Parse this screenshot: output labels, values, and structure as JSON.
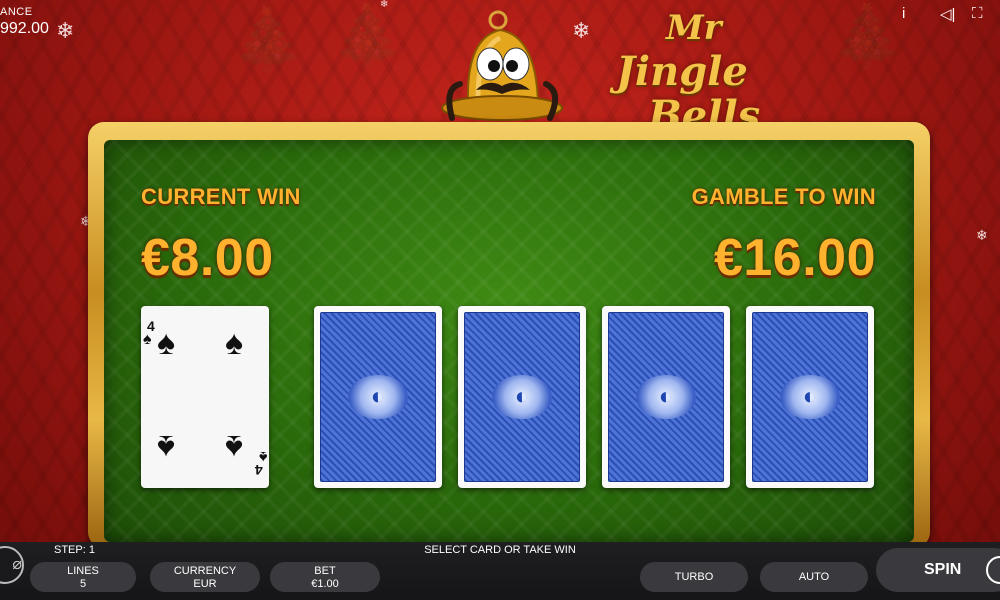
{
  "balance": {
    "label": "ANCE",
    "value": "992.00"
  },
  "topbar": {
    "info_icon": "i",
    "sound_icon": "◁|",
    "fullscreen_icon": "⛶"
  },
  "logo": {
    "mr": "Mr",
    "jingle": "Jingle",
    "bells": "Bells"
  },
  "gamble": {
    "current_win_label": "CURRENT WIN",
    "current_win_value": "€8.00",
    "gamble_to_win_label": "GAMBLE TO WIN",
    "gamble_to_win_value": "€16.00"
  },
  "cards": {
    "revealed": {
      "rank": "4",
      "suit": "♠"
    },
    "face_down_count_label": ""
  },
  "bottom": {
    "step_label": "STEP: 1",
    "instruction": "SELECT CARD OR TAKE WIN",
    "lines_label": "LINES",
    "lines_value": "5",
    "currency_label": "CURRENCY",
    "currency_value": "EUR",
    "bet_label": "BET",
    "bet_value": "€1.00",
    "turbo_label": "TURBO",
    "auto_label": "AUTO",
    "spin_label": "SPIN"
  },
  "colors": {
    "win_text": "#ffb22e",
    "panel_green": "#2a6a0b",
    "background_red": "#9d1712",
    "card_back_blue": "#3b5fc7"
  },
  "icons": [
    "info-icon",
    "sound-icon",
    "fullscreen-icon",
    "snowflake-icon",
    "bell-mascot-icon",
    "spade-icon",
    "settings-icon"
  ]
}
